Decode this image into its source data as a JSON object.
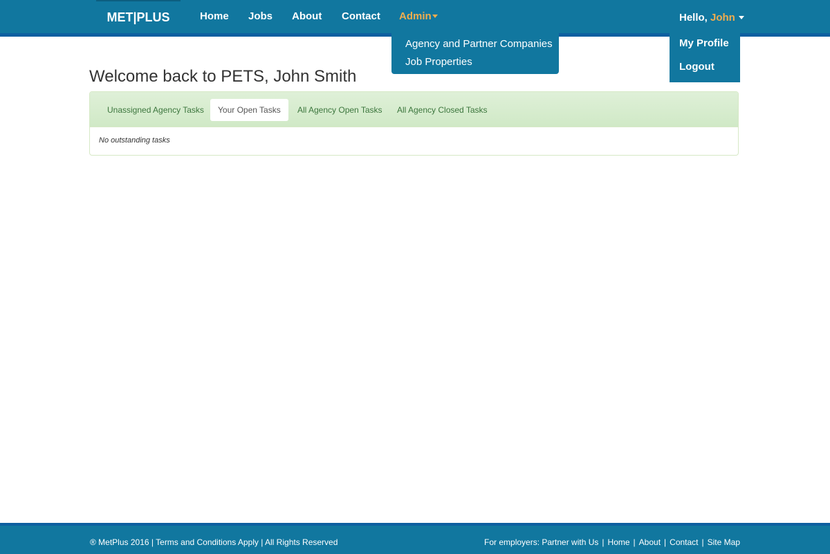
{
  "navbar": {
    "brand": "MET|PLUS",
    "links": {
      "home": "Home",
      "jobs": "Jobs",
      "about": "About",
      "contact": "Contact",
      "admin": "Admin"
    },
    "user_greeting": "Hello, ",
    "user_name": "John",
    "admin_menu": [
      "Agency and Partner Companies",
      "Job Properties"
    ],
    "user_menu": [
      "My Profile",
      "Logout"
    ]
  },
  "main": {
    "title": "Welcome back to PETS, John Smith",
    "tabs": [
      "Unassigned Agency Tasks",
      "Your Open Tasks",
      "All Agency Open Tasks",
      "All Agency Closed Tasks"
    ],
    "active_tab": "Your Open Tasks",
    "empty_message": "No outstanding tasks"
  },
  "footer": {
    "left": {
      "copyright": "® MetPlus 2016",
      "terms": "Terms and Conditions Apply",
      "rights": "All Rights Reserved"
    },
    "right": {
      "employers": "For employers: Partner with Us",
      "home": "Home",
      "about": "About",
      "contact": "Contact",
      "sitemap": "Site Map"
    }
  },
  "colors": {
    "primary": "#11779f",
    "accent": "#f0ad4e",
    "panel_green": "#dff0d8",
    "tab_text": "#3c763d"
  }
}
